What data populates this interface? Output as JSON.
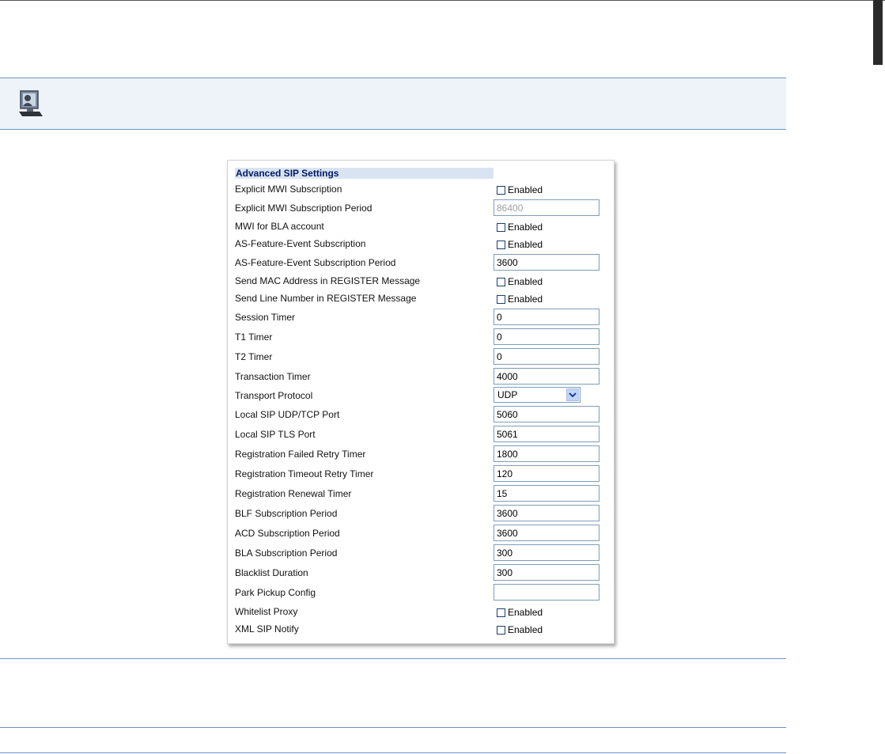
{
  "section": {
    "title": "Advanced SIP Settings"
  },
  "colors": {
    "accent_rule": "#6f93bf",
    "note_bg": "#eef3f9",
    "section_bg": "#d9e4f2"
  },
  "icons": {
    "note": "computer-person-icon",
    "select_arrow": "chevron-down-icon"
  },
  "rows": {
    "explicit_mwi": {
      "label": "Explicit MWI Subscription",
      "checkbox": "Enabled"
    },
    "explicit_mwi_period": {
      "label": "Explicit MWI Subscription Period",
      "value": "86400"
    },
    "mwi_bla": {
      "label": "MWI for BLA account",
      "checkbox": "Enabled"
    },
    "as_feature": {
      "label": "AS-Feature-Event Subscription",
      "checkbox": "Enabled"
    },
    "as_feature_period": {
      "label": "AS-Feature-Event Subscription Period",
      "value": "3600"
    },
    "send_mac": {
      "label": "Send MAC Address in REGISTER Message",
      "checkbox": "Enabled"
    },
    "send_line": {
      "label": "Send Line Number in REGISTER Message",
      "checkbox": "Enabled"
    },
    "session_timer": {
      "label": "Session Timer",
      "value": "0"
    },
    "t1_timer": {
      "label": "T1 Timer",
      "value": "0"
    },
    "t2_timer": {
      "label": "T2 Timer",
      "value": "0"
    },
    "transaction_timer": {
      "label": "Transaction Timer",
      "value": "4000"
    },
    "transport_protocol": {
      "label": "Transport Protocol",
      "value": "UDP"
    },
    "local_udp_tcp": {
      "label": "Local SIP UDP/TCP Port",
      "value": "5060"
    },
    "local_tls": {
      "label": "Local SIP TLS Port",
      "value": "5061"
    },
    "reg_failed": {
      "label": "Registration Failed Retry Timer",
      "value": "1800"
    },
    "reg_timeout": {
      "label": "Registration Timeout Retry Timer",
      "value": "120"
    },
    "reg_renewal": {
      "label": "Registration Renewal Timer",
      "value": "15"
    },
    "blf_period": {
      "label": "BLF Subscription Period",
      "value": "3600"
    },
    "acd_period": {
      "label": "ACD Subscription Period",
      "value": "3600"
    },
    "bla_period": {
      "label": "BLA Subscription Period",
      "value": "300"
    },
    "blacklist": {
      "label": "Blacklist Duration",
      "value": "300"
    },
    "park_pickup": {
      "label": "Park Pickup Config",
      "value": ""
    },
    "whitelist": {
      "label": "Whitelist Proxy",
      "checkbox": "Enabled"
    },
    "xml_sip": {
      "label": "XML SIP Notify",
      "checkbox": "Enabled"
    }
  }
}
